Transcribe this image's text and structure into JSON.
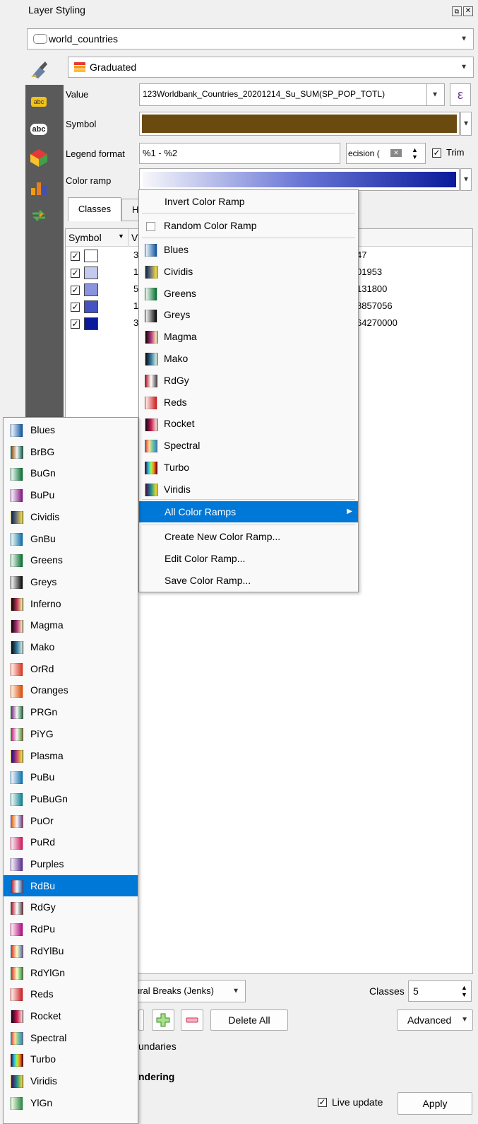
{
  "panel": {
    "title": "Layer Styling"
  },
  "layer_combo": {
    "value": "world_countries"
  },
  "renderer_combo": {
    "value": "Graduated"
  },
  "fields": {
    "value_label": "Value",
    "value_expr_prefix": "123",
    "value_expr": "Worldbank_Countries_20201214_Su_SUM(SP_POP_TOTL)",
    "epsilon": "ε",
    "symbol_label": "Symbol",
    "symbol_color": "#6b4a10",
    "legend_label": "Legend format",
    "legend_value": "%1 - %2",
    "precision_value": "ecision (",
    "trim_label": "Trim",
    "color_ramp_label": "Color ramp"
  },
  "tabs": {
    "classes": "Classes",
    "histogram": "H"
  },
  "class_table": {
    "symbol_header": "Symbol",
    "value_header": "V",
    "rows": [
      {
        "color": "#ffffff",
        "v": "3",
        "legend": "47"
      },
      {
        "color": "#c4c9ef",
        "v": "1",
        "legend": "01953"
      },
      {
        "color": "#8a93dd",
        "v": "5",
        "legend": "131800"
      },
      {
        "color": "#4552c4",
        "v": "1",
        "legend": "8857056"
      },
      {
        "color": "#0a1a9a",
        "v": "3",
        "legend": "64270000"
      }
    ]
  },
  "ramp_menu": {
    "invert": "Invert Color Ramp",
    "random": "Random Color Ramp",
    "ramps": [
      {
        "name": "Blues",
        "gradient": "linear-gradient(90deg,#f7fbff,#08519c)"
      },
      {
        "name": "Cividis",
        "gradient": "linear-gradient(90deg,#00224e,#7c7b78,#fee838)"
      },
      {
        "name": "Greens",
        "gradient": "linear-gradient(90deg,#f7fcf5,#006d2c)"
      },
      {
        "name": "Greys",
        "gradient": "linear-gradient(90deg,#ffffff,#000000)"
      },
      {
        "name": "Magma",
        "gradient": "linear-gradient(90deg,#000004,#b63679,#fcfdbf)"
      },
      {
        "name": "Mako",
        "gradient": "linear-gradient(90deg,#0b0405,#357ba2,#def5e5)"
      },
      {
        "name": "RdGy",
        "gradient": "linear-gradient(90deg,#b2182b,#ffffff,#4d4d4d)"
      },
      {
        "name": "Reds",
        "gradient": "linear-gradient(90deg,#fff5f0,#cb181d)"
      },
      {
        "name": "Rocket",
        "gradient": "linear-gradient(90deg,#03051a,#cb1b4f,#faebdd)"
      },
      {
        "name": "Spectral",
        "gradient": "linear-gradient(90deg,#d53e4f,#fee08b,#66c2a5,#3288bd)"
      },
      {
        "name": "Turbo",
        "gradient": "linear-gradient(90deg,#30123b,#28bbec,#a2fc3c,#fb8022,#7a0403)"
      },
      {
        "name": "Viridis",
        "gradient": "linear-gradient(90deg,#440154,#21918c,#fde725)"
      }
    ],
    "all_ramps": "All Color Ramps",
    "create": "Create New Color Ramp...",
    "edit": "Edit Color Ramp...",
    "save": "Save Color Ramp..."
  },
  "sub_menu": {
    "selected": "RdBu",
    "ramps": [
      {
        "name": "Blues",
        "gradient": "linear-gradient(90deg,#f7fbff,#08519c)"
      },
      {
        "name": "BrBG",
        "gradient": "linear-gradient(90deg,#8c510a,#f5f5f5,#01665e)"
      },
      {
        "name": "BuGn",
        "gradient": "linear-gradient(90deg,#f7fcfd,#006d2c)"
      },
      {
        "name": "BuPu",
        "gradient": "linear-gradient(90deg,#f7fcfd,#810f7c)"
      },
      {
        "name": "Cividis",
        "gradient": "linear-gradient(90deg,#00224e,#7c7b78,#fee838)"
      },
      {
        "name": "GnBu",
        "gradient": "linear-gradient(90deg,#f7fcf0,#0868ac)"
      },
      {
        "name": "Greens",
        "gradient": "linear-gradient(90deg,#f7fcf5,#006d2c)"
      },
      {
        "name": "Greys",
        "gradient": "linear-gradient(90deg,#ffffff,#000000)"
      },
      {
        "name": "Inferno",
        "gradient": "linear-gradient(90deg,#000004,#bc3754,#fcffa4)"
      },
      {
        "name": "Magma",
        "gradient": "linear-gradient(90deg,#000004,#b63679,#fcfdbf)"
      },
      {
        "name": "Mako",
        "gradient": "linear-gradient(90deg,#0b0405,#357ba2,#def5e5)"
      },
      {
        "name": "OrRd",
        "gradient": "linear-gradient(90deg,#fff7ec,#d7301f)"
      },
      {
        "name": "Oranges",
        "gradient": "linear-gradient(90deg,#fff5eb,#d94801)"
      },
      {
        "name": "PRGn",
        "gradient": "linear-gradient(90deg,#762a83,#f7f7f7,#1b7837)"
      },
      {
        "name": "PiYG",
        "gradient": "linear-gradient(90deg,#c51b7d,#f7f7f7,#4d9221)"
      },
      {
        "name": "Plasma",
        "gradient": "linear-gradient(90deg,#0d0887,#cc4778,#f0f921)"
      },
      {
        "name": "PuBu",
        "gradient": "linear-gradient(90deg,#fff7fb,#0570b0)"
      },
      {
        "name": "PuBuGn",
        "gradient": "linear-gradient(90deg,#fff7fb,#02818a)"
      },
      {
        "name": "PuOr",
        "gradient": "linear-gradient(90deg,#e66101,#f7f7f7,#5e3c99)"
      },
      {
        "name": "PuRd",
        "gradient": "linear-gradient(90deg,#f7f4f9,#ce1256)"
      },
      {
        "name": "Purples",
        "gradient": "linear-gradient(90deg,#fcfbfd,#54278f)"
      },
      {
        "name": "RdBu",
        "gradient": "linear-gradient(90deg,#b2182b,#f7f7f7,#2166ac)"
      },
      {
        "name": "RdGy",
        "gradient": "linear-gradient(90deg,#b2182b,#ffffff,#4d4d4d)"
      },
      {
        "name": "RdPu",
        "gradient": "linear-gradient(90deg,#fff7f3,#ae017e)"
      },
      {
        "name": "RdYlBu",
        "gradient": "linear-gradient(90deg,#d73027,#ffffbf,#4575b4)"
      },
      {
        "name": "RdYlGn",
        "gradient": "linear-gradient(90deg,#d73027,#ffffbf,#1a9850)"
      },
      {
        "name": "Reds",
        "gradient": "linear-gradient(90deg,#fff5f0,#cb181d)"
      },
      {
        "name": "Rocket",
        "gradient": "linear-gradient(90deg,#03051a,#cb1b4f,#faebdd)"
      },
      {
        "name": "Spectral",
        "gradient": "linear-gradient(90deg,#d53e4f,#fee08b,#66c2a5,#3288bd)"
      },
      {
        "name": "Turbo",
        "gradient": "linear-gradient(90deg,#30123b,#28bbec,#a2fc3c,#fb8022,#7a0403)"
      },
      {
        "name": "Viridis",
        "gradient": "linear-gradient(90deg,#440154,#21918c,#fde725)"
      },
      {
        "name": "YlGn",
        "gradient": "linear-gradient(90deg,#ffffe5,#238443)"
      }
    ]
  },
  "bottom": {
    "mode": "ural Breaks (Jenks)",
    "classes_label": "Classes",
    "classes_value": "5",
    "delete_all": "Delete All",
    "advanced": "Advanced",
    "boundaries": "undaries",
    "rendering": "ndering",
    "live_update": "Live update",
    "apply": "Apply"
  }
}
